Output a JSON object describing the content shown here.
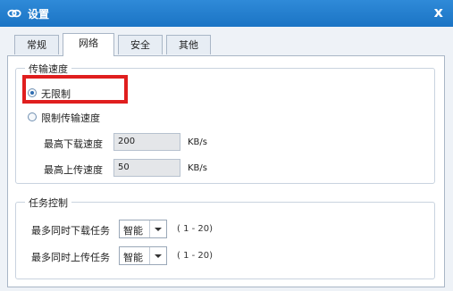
{
  "window": {
    "title": "设置",
    "close_label": "x"
  },
  "tabs": [
    {
      "label": "常规"
    },
    {
      "label": "网络"
    },
    {
      "label": "安全"
    },
    {
      "label": "其他"
    }
  ],
  "active_tab": "网络",
  "transfer_speed": {
    "title": "传输速度",
    "unlimited_label": "无限制",
    "limited_label": "限制传输速度",
    "selected": "无限制",
    "max_download_label": "最高下载速度",
    "max_download_value": "200",
    "max_upload_label": "最高上传速度",
    "max_upload_value": "50",
    "unit": "KB/s"
  },
  "task_control": {
    "title": "任务控制",
    "max_download_tasks_label": "最多同时下载任务",
    "max_download_tasks_value": "智能",
    "max_upload_tasks_label": "最多同时上传任务",
    "max_upload_tasks_value": "智能",
    "range_hint": "( 1 - 20)"
  },
  "colors": {
    "titlebar": "#1b74c4",
    "highlight_box": "#e01e1e"
  },
  "icons": {
    "app_logo": "link-cloud-icon",
    "close": "close-icon",
    "dropdown": "chevron-down-icon"
  }
}
